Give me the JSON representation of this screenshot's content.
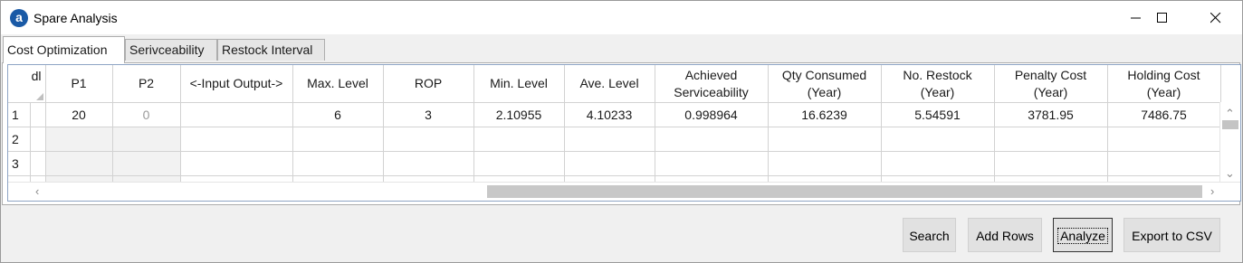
{
  "window": {
    "title": "Spare Analysis"
  },
  "tabs": [
    {
      "label": "Cost Optimization",
      "active": true
    },
    {
      "label": "Serivceability",
      "active": false
    },
    {
      "label": "Restock Interval",
      "active": false
    }
  ],
  "grid": {
    "corner_label": "dl",
    "columns": [
      [
        "P1"
      ],
      [
        "P2"
      ],
      [
        "<-Input  Output->"
      ],
      [
        "Max. Level"
      ],
      [
        "ROP"
      ],
      [
        "Min. Level"
      ],
      [
        "Ave. Level"
      ],
      [
        "Achieved",
        "Serviceability"
      ],
      [
        "Qty Consumed",
        "(Year)"
      ],
      [
        "No. Restock",
        "(Year)"
      ],
      [
        "Penalty Cost",
        "(Year)"
      ],
      [
        "Holding Cost",
        "(Year)"
      ]
    ],
    "rows": [
      {
        "num": "1",
        "cells": [
          "20",
          "0",
          "",
          "6",
          "3",
          "2.10955",
          "4.10233",
          "0.998964",
          "16.6239",
          "5.54591",
          "3781.95",
          "7486.75"
        ]
      },
      {
        "num": "2",
        "cells": [
          "",
          "",
          "",
          "",
          "",
          "",
          "",
          "",
          "",
          "",
          "",
          ""
        ]
      },
      {
        "num": "3",
        "cells": [
          "",
          "",
          "",
          "",
          "",
          "",
          "",
          "",
          "",
          "",
          "",
          ""
        ]
      },
      {
        "num": "",
        "cells": [
          "",
          "",
          "",
          "",
          "",
          "",
          "",
          "",
          "",
          "",
          "",
          ""
        ]
      }
    ]
  },
  "buttons": {
    "search": "Search",
    "add_rows": "Add Rows",
    "analyze": "Analyze",
    "export": "Export to CSV"
  },
  "icons": {
    "app": "app-logo-icon",
    "minimize": "minimize-icon",
    "maximize": "maximize-icon",
    "close": "close-icon"
  },
  "colors": {
    "app_icon": "#1a5aa6",
    "grid_border": "#8ea4c4"
  }
}
